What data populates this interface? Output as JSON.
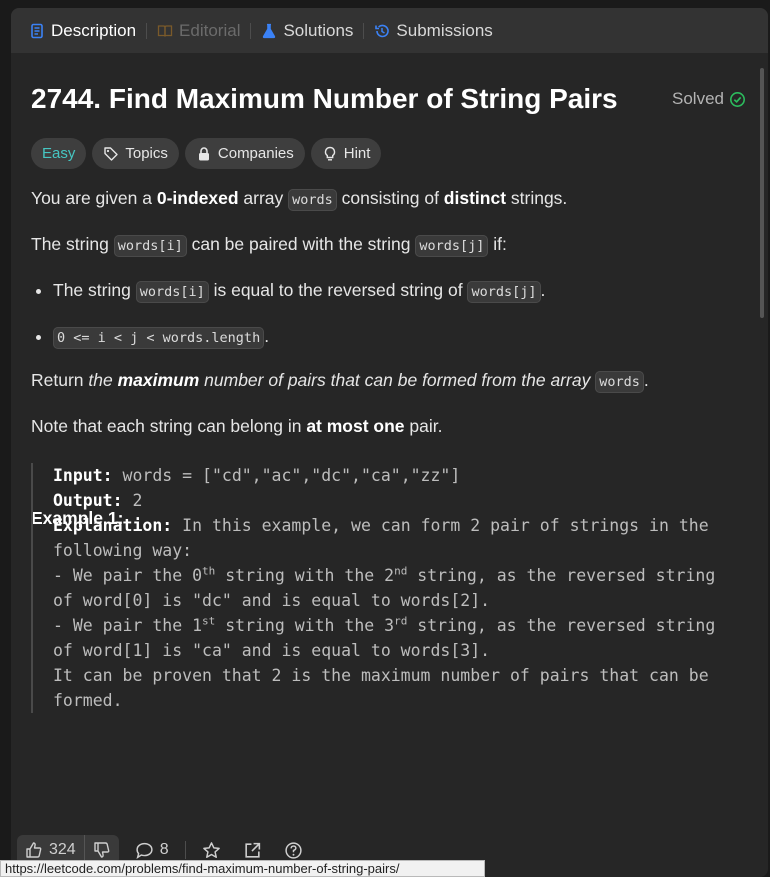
{
  "tabs": [
    {
      "label": "Description",
      "icon": "description-icon",
      "state": "active"
    },
    {
      "label": "Editorial",
      "icon": "book-icon",
      "state": "disabled"
    },
    {
      "label": "Solutions",
      "icon": "flask-icon",
      "state": "normal"
    },
    {
      "label": "Submissions",
      "icon": "history-icon",
      "state": "normal"
    }
  ],
  "problem": {
    "title": "2744. Find Maximum Number of String Pairs",
    "solved_label": "Solved",
    "chips": {
      "difficulty": "Easy",
      "topics": "Topics",
      "companies": "Companies",
      "hint": "Hint"
    }
  },
  "desc": {
    "p1": {
      "a": "You are given a ",
      "b": "0-indexed",
      "c": " array ",
      "code": "words",
      "d": " consisting of ",
      "e": "distinct",
      "f": " strings."
    },
    "p2": {
      "a": "The string ",
      "code1": "words[i]",
      "b": " can be paired with the string ",
      "code2": "words[j]",
      "c": " if:"
    },
    "li1": {
      "a": "The string ",
      "code1": "words[i]",
      "b": " is equal to the reversed string of ",
      "code2": "words[j]",
      "c": "."
    },
    "li2": {
      "code": "0 <= i < j < words.length",
      "c": "."
    },
    "p3": {
      "a": "Return ",
      "b": "the ",
      "c": "maximum",
      "d": " number of pairs that can be formed from the array ",
      "code": "words",
      "e": "."
    },
    "p4": {
      "a": "Note that each string can belong in ",
      "b": "at most one",
      "c": " pair."
    }
  },
  "example1": {
    "heading": "Example 1:",
    "input_label": "Input:",
    "input_value": " words = [\"cd\",\"ac\",\"dc\",\"ca\",\"zz\"]",
    "output_label": "Output:",
    "output_value": " 2",
    "explanation_label": "Explanation:",
    "explanation_intro": " In this example, we can form 2 pair of strings in the following way:",
    "line1": {
      "a": "- We pair the 0",
      "sup1": "th",
      "b": " string with the 2",
      "sup2": "nd",
      "c": " string, as the reversed string of word[0] is \"dc\" and is equal to words[2]."
    },
    "line2": {
      "a": "- We pair the 1",
      "sup1": "st",
      "b": " string with the 3",
      "sup2": "rd",
      "c": " string, as the reversed string of word[1] is \"ca\" and is equal to words[3]."
    },
    "conclusion": "It can be proven that 2 is the maximum number of pairs that can be formed."
  },
  "footer": {
    "likes": "324",
    "comments": "8"
  },
  "status_url": "https://leetcode.com/problems/find-maximum-number-of-string-pairs/",
  "colors": {
    "easy": "#46c6c2",
    "solved": "#2cbb5d",
    "tab_active_icon": "#3b82f6",
    "solutions_icon": "#3b82f6"
  }
}
